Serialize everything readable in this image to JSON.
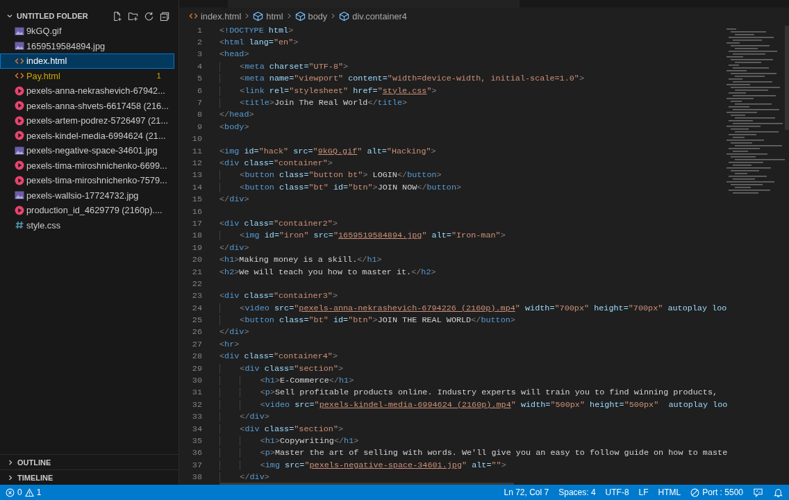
{
  "explorer": {
    "title": "UNTITLED FOLDER",
    "expanded": true,
    "files": [
      {
        "name": "9kGQ.gif",
        "kind": "image",
        "selected": false,
        "warning": false
      },
      {
        "name": "1659519584894.jpg",
        "kind": "image",
        "selected": false,
        "warning": false
      },
      {
        "name": "index.html",
        "kind": "html",
        "selected": true,
        "warning": false
      },
      {
        "name": "Pay.html",
        "kind": "html",
        "selected": false,
        "warning": true,
        "badge": "1"
      },
      {
        "name": "pexels-anna-nekrashevich-67942...",
        "kind": "video",
        "selected": false,
        "warning": false
      },
      {
        "name": "pexels-anna-shvets-6617458 (216...",
        "kind": "video",
        "selected": false,
        "warning": false
      },
      {
        "name": "pexels-artem-podrez-5726497 (21...",
        "kind": "video",
        "selected": false,
        "warning": false
      },
      {
        "name": "pexels-kindel-media-6994624 (21...",
        "kind": "video",
        "selected": false,
        "warning": false
      },
      {
        "name": "pexels-negative-space-34601.jpg",
        "kind": "image",
        "selected": false,
        "warning": false
      },
      {
        "name": "pexels-tima-miroshnichenko-6699...",
        "kind": "video",
        "selected": false,
        "warning": false
      },
      {
        "name": "pexels-tima-miroshnichenko-7579...",
        "kind": "video",
        "selected": false,
        "warning": false
      },
      {
        "name": "pexels-wallsio-17724732.jpg",
        "kind": "image",
        "selected": false,
        "warning": false
      },
      {
        "name": "production_id_4629779 (2160p)....",
        "kind": "video",
        "selected": false,
        "warning": false
      },
      {
        "name": "style.css",
        "kind": "css",
        "selected": false,
        "warning": false
      }
    ]
  },
  "panels": [
    {
      "title": "OUTLINE",
      "expanded": false
    },
    {
      "title": "TIMELINE",
      "expanded": false
    }
  ],
  "breadcrumbs": [
    {
      "text": "index.html",
      "kind": "file"
    },
    {
      "text": "html",
      "kind": "element"
    },
    {
      "text": "body",
      "kind": "element"
    },
    {
      "text": "div.container4",
      "kind": "element"
    }
  ],
  "code_lines": [
    {
      "number": "1",
      "code": "<!DOCTYPE html>"
    },
    {
      "number": "2",
      "code": "<html lang=\"en\">"
    },
    {
      "number": "3",
      "code": "<head>"
    },
    {
      "number": "4",
      "code": "    <meta charset=\"UTF-8\">"
    },
    {
      "number": "5",
      "code": "    <meta name=\"viewport\" content=\"width=device-width, initial-scale=1.0\">"
    },
    {
      "number": "6",
      "code": "    <link rel=\"stylesheet\" href=\"style.css\">"
    },
    {
      "number": "7",
      "code": "    <title>Join The Real World</title>"
    },
    {
      "number": "8",
      "code": "</head>"
    },
    {
      "number": "9",
      "code": "<body>"
    },
    {
      "number": "10"
    },
    {
      "number": "11",
      "code": "<img id=\"hack\" src=\"9kGQ.gif\" alt=\"Hacking\">"
    },
    {
      "number": "12",
      "code": "<div class=\"container\">"
    },
    {
      "number": "13",
      "code": "    <button class=\"button bt\"> LOGIN</button>"
    },
    {
      "number": "14",
      "code": "    <button class=\"bt\" id=\"btn\">JOIN NOW</button>"
    },
    {
      "number": "15",
      "code": "</div>"
    },
    {
      "number": "16"
    },
    {
      "number": "17",
      "code": "<div class=\"container2\">"
    },
    {
      "number": "18",
      "code": "    <img id=\"iron\" src=\"1659519584894.jpg\" alt=\"Iron-man\">"
    },
    {
      "number": "19",
      "code": "</div>"
    },
    {
      "number": "20",
      "code": "<h1>Making money is a skill.</h1>"
    },
    {
      "number": "21",
      "code": "<h2>We will teach you how to master it.</h2>"
    },
    {
      "number": "22"
    },
    {
      "number": "23",
      "code": "<div class=\"container3\">"
    },
    {
      "number": "24",
      "code": "    <video src=\"pexels-anna-nekrashevich-6794226 (2160p).mp4\" width=\"700px\" height=\"700px\" autoplay loo"
    },
    {
      "number": "25",
      "code": "    <button class=\"bt\" id=\"btn\">JOIN THE REAL WORLD</button>"
    },
    {
      "number": "26",
      "code": "</div>"
    },
    {
      "number": "27",
      "code": "<hr>"
    },
    {
      "number": "28",
      "code": "<div class=\"container4\">"
    },
    {
      "number": "29",
      "code": "    <div class=\"section\">"
    },
    {
      "number": "30",
      "code": "        <h1>E-Commerce</h1>"
    },
    {
      "number": "31",
      "code": "        <p>Sell profitable products online. Industry experts will train you to find winning products,"
    },
    {
      "number": "32",
      "code": "        <video src=\"pexels-kindel-media-6994624 (2160p).mp4\" width=\"500px\" height=\"500px\"  autoplay loo"
    },
    {
      "number": "33",
      "code": "    </div>"
    },
    {
      "number": "34",
      "code": "    <div class=\"section\">"
    },
    {
      "number": "35",
      "code": "        <h1>Copywriting</h1>"
    },
    {
      "number": "36",
      "code": "        <p>Master the art of selling with words. We'll give you an easy to follow guide on how to maste"
    },
    {
      "number": "37",
      "code": "        <img src=\"pexels-negative-space-34601.jpg\" alt=\"\">"
    },
    {
      "number": "38",
      "code": "    </div>"
    }
  ],
  "status_bar": {
    "errors": "0",
    "warnings": "1",
    "position": "Ln 72, Col 7",
    "indent": "Spaces: 4",
    "encoding": "UTF-8",
    "eol": "LF",
    "language": "HTML",
    "port": "Port : 5500"
  }
}
